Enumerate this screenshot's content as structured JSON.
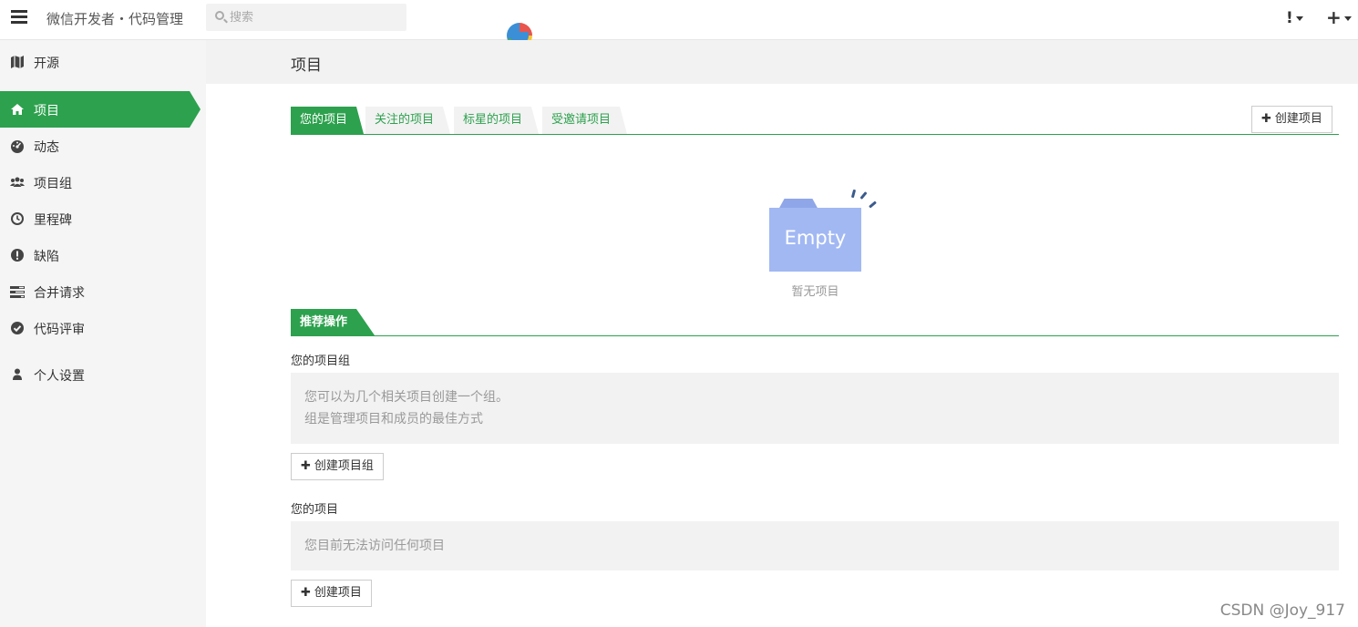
{
  "topbar": {
    "title": "微信开发者・代码管理",
    "search_placeholder": "搜索",
    "alert_label": "!",
    "add_label": "+"
  },
  "sidebar": {
    "items": [
      {
        "label": "开源",
        "icon": "map-icon"
      },
      {
        "label": "项目",
        "icon": "home-icon",
        "active": true
      },
      {
        "label": "动态",
        "icon": "dashboard-icon"
      },
      {
        "label": "项目组",
        "icon": "users-icon"
      },
      {
        "label": "里程碑",
        "icon": "clock-icon"
      },
      {
        "label": "缺陷",
        "icon": "exclamation-circle-icon"
      },
      {
        "label": "合并请求",
        "icon": "tasks-icon"
      },
      {
        "label": "代码评审",
        "icon": "check-circle-icon"
      },
      {
        "label": "个人设置",
        "icon": "user-icon"
      }
    ]
  },
  "main": {
    "page_title": "项目",
    "tabs": [
      "您的项目",
      "关注的项目",
      "标星的项目",
      "受邀请项目"
    ],
    "create_project_label": "创建项目",
    "empty": {
      "image_text": "Empty",
      "caption": "暂无项目"
    },
    "recommend": {
      "title": "推荐操作",
      "groups_label": "您的项目组",
      "groups_info": [
        "您可以为几个相关项目创建一个组。",
        "组是管理项目和成员的最佳方式"
      ],
      "create_group_label": "创建项目组",
      "projects_label": "您的项目",
      "projects_info": "您目前无法访问任何项目",
      "create_project_label": "创建项目"
    }
  },
  "watermark": "CSDN @Joy_917",
  "colors": {
    "accent": "#2da14e",
    "empty_folder": "#a2b8f3",
    "sidebar_bg": "#f5f5f5"
  }
}
